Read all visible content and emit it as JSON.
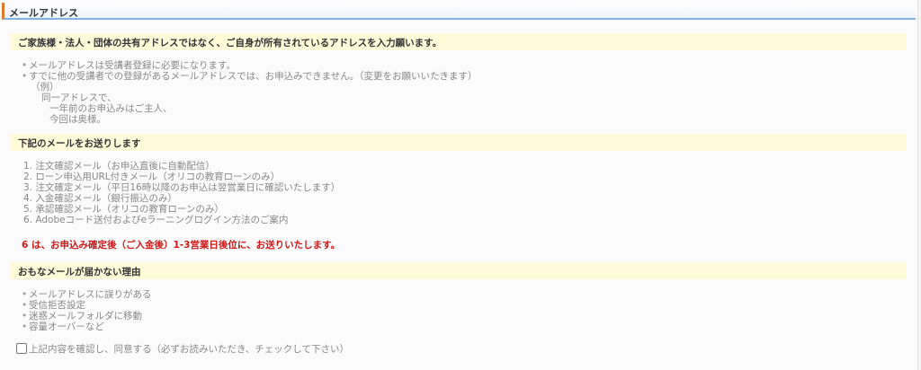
{
  "header": {
    "title": "メールアドレス"
  },
  "section1": {
    "title": "ご家族様・法人・団体の共有アドレスではなく、ご自身が所有されているアドレスを入力願います。",
    "items": [
      "メールアドレスは受講者登録に必要になります。",
      "すでに他の受講者での登録があるメールアドレスでは、お申込みできません。（変更をお願いいたきます）"
    ],
    "example_label": "（例）",
    "example_lines": [
      "同一アドレスで、",
      "一年前のお申込みはご主人、",
      "今回は奥様。"
    ]
  },
  "section2": {
    "title": "下記のメールをお送りします",
    "items": [
      "1. 注文確認メール（お申込直後に自動配信）",
      "2. ローン申込用URL付きメール（オリコの教育ローンのみ）",
      "3. 注文確定メール（平日16時以降のお申込は翌営業日に確認いたします）",
      "4. 入金確認メール（銀行振込のみ）",
      "5. 承認確認メール（オリコの教育ローンのみ）",
      "6. Adobeコード送付およびeラーニングログイン方法のご案内"
    ],
    "notice": "6 は、お申込み確定後（ご入金後）1-3営業日後位に、お送りいたします。"
  },
  "section3": {
    "title": "おもなメールが届かない理由",
    "items": [
      "メールアドレスに誤りがある",
      "受信拒否設定",
      "迷惑メールフォルダに移動",
      "容量オーバーなど"
    ]
  },
  "agree": {
    "label": "上記内容を確認し、同意する（必ずお読みいただき、チェックして下さい）"
  }
}
